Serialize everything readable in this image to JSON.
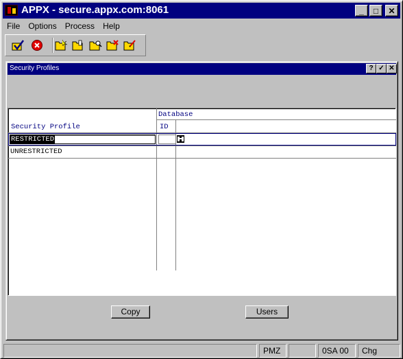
{
  "window": {
    "title": "APPX - secure.appx.com:8061",
    "controls": {
      "minimize": "_",
      "maximize": "□",
      "close": "✕"
    }
  },
  "menubar": {
    "items": [
      {
        "label": "File"
      },
      {
        "label": "Options"
      },
      {
        "label": "Process"
      },
      {
        "label": "Help"
      }
    ]
  },
  "toolbar": {
    "tools": [
      {
        "icon": "check-icon"
      },
      {
        "icon": "cancel-icon"
      },
      {
        "icon": "new-folder-icon"
      },
      {
        "icon": "open-folder-icon"
      },
      {
        "icon": "search-folder-icon"
      },
      {
        "icon": "delete-folder-icon"
      },
      {
        "icon": "edit-folder-icon"
      }
    ],
    "colors": {
      "check": "#000080",
      "cancel": "#e00000",
      "folder": "#ffd800"
    }
  },
  "child_window": {
    "title": "Security Profiles",
    "controls": {
      "help": "?",
      "ok": "✓",
      "close": "✕"
    }
  },
  "grid": {
    "header_group": "Database",
    "columns": [
      {
        "label": "Security Profile"
      },
      {
        "label": "ID"
      }
    ],
    "rows": [
      {
        "profile": "RESTRICTED",
        "id": "",
        "selected": true
      },
      {
        "profile": "UNRESTRICTED",
        "id": "",
        "selected": false
      }
    ]
  },
  "buttons": {
    "copy": "Copy",
    "users": "Users"
  },
  "statusbar": {
    "cells": [
      "",
      "PMZ",
      "",
      "0SA 00",
      "Chg"
    ]
  },
  "colors": {
    "titlebar": "#000080",
    "header_text": "#000080",
    "face": "#c0c0c0"
  }
}
